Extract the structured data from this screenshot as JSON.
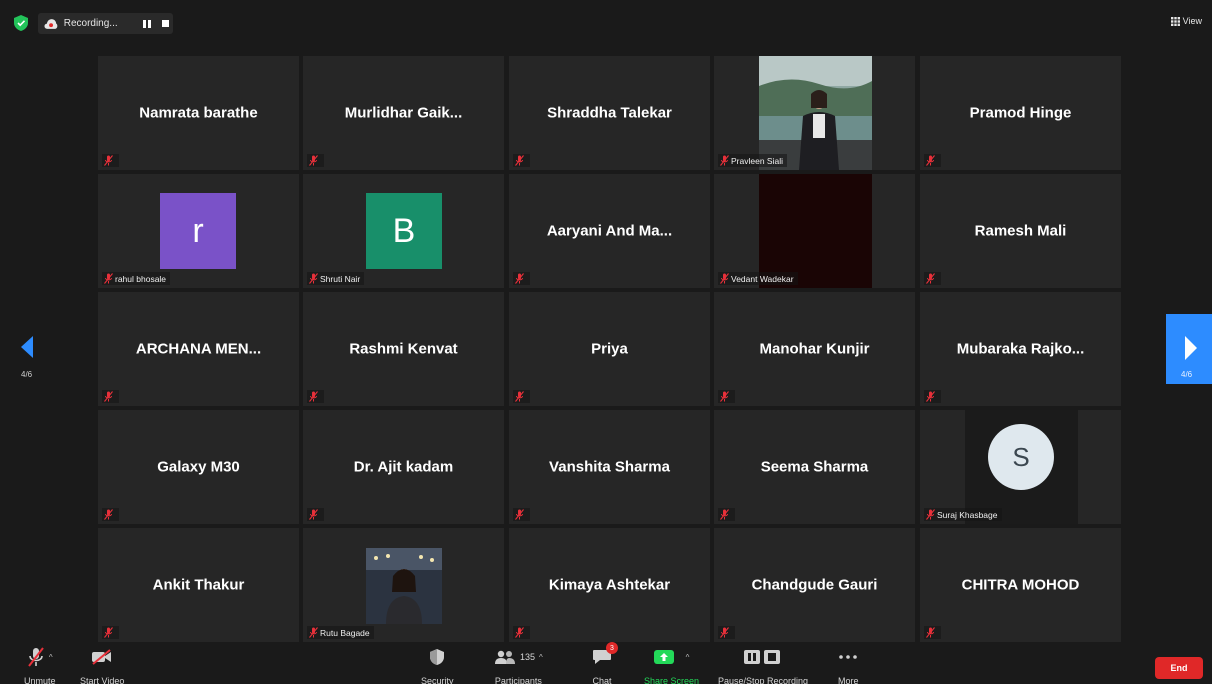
{
  "topbar": {
    "recording_label": "Recording...",
    "view_label": "View"
  },
  "nav": {
    "left_page": "4/6",
    "right_page": "4/6"
  },
  "tiles": [
    {
      "name": "Namrata barathe"
    },
    {
      "name": "Murlidhar  Gaik..."
    },
    {
      "name": "Shraddha Talekar"
    },
    {
      "tag": "Pravleen Siali"
    },
    {
      "name": "Pramod Hinge"
    },
    {
      "initial": "r",
      "tag": "rahul bhosale",
      "color": "#7a52c8"
    },
    {
      "initial": "B",
      "tag": "Shruti Nair",
      "color": "#188f6a"
    },
    {
      "name": "Aaryani And Ma..."
    },
    {
      "tag": "Vedant Wadekar"
    },
    {
      "name": "Ramesh Mali"
    },
    {
      "name": "ARCHANA  MEN..."
    },
    {
      "name": "Rashmi Kenvat"
    },
    {
      "name": "Priya"
    },
    {
      "name": "Manohar Kunjir"
    },
    {
      "name": "Mubaraka  Rajko..."
    },
    {
      "name": "Galaxy M30"
    },
    {
      "name": "Dr. Ajit kadam"
    },
    {
      "name": "Vanshita Sharma"
    },
    {
      "name": "Seema Sharma"
    },
    {
      "initial": "S",
      "tag": "Suraj Khasbage"
    },
    {
      "name": "Ankit Thakur"
    },
    {
      "tag": "Rutu Bagade"
    },
    {
      "name": "Kimaya Ashtekar"
    },
    {
      "name": "Chandgude Gauri"
    },
    {
      "name": "CHITRA MOHOD"
    }
  ],
  "toolbar": {
    "unmute": "Unmute",
    "start_video": "Start Video",
    "security": "Security",
    "participants": "Participants",
    "participants_count": "135",
    "chat": "Chat",
    "chat_badge": "3",
    "share_screen": "Share Screen",
    "pause_stop": "Pause/Stop Recording",
    "more": "More",
    "end": "End"
  },
  "colors": {
    "share_green": "#23d959",
    "end_red": "#e02828",
    "nav_blue": "#2d8cff",
    "muted_red": "#e8303a"
  }
}
